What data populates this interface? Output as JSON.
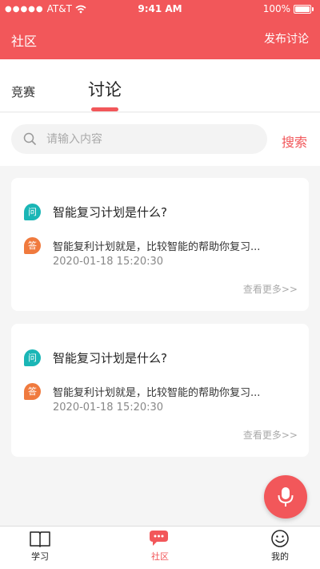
{
  "status_bar": {
    "carrier": "AT&T",
    "time": "9:41 AM",
    "battery": "100%"
  },
  "header": {
    "title": "社区",
    "action": "发布讨论"
  },
  "tabs": [
    {
      "label": "竞赛",
      "active": false
    },
    {
      "label": "讨论",
      "active": true
    }
  ],
  "search": {
    "placeholder": "请输入内容",
    "button": "搜索"
  },
  "posts": [
    {
      "question_badge": "问",
      "question": "智能复习计划是什么?",
      "answer_badge": "答",
      "answer": "智能复利计划就是，比较智能的帮助你复习...",
      "timestamp": "2020-01-18   15:20:30",
      "more": "查看更多>>"
    },
    {
      "question_badge": "问",
      "question": "智能复习计划是什么?",
      "answer_badge": "答",
      "answer": "智能复利计划就是，比较智能的帮助你复习...",
      "timestamp": "2020-01-18   15:20:30",
      "more": "查看更多>>"
    }
  ],
  "tabbar": [
    {
      "label": "学习",
      "icon": "book-icon"
    },
    {
      "label": "社区",
      "icon": "chat-icon",
      "active": true
    },
    {
      "label": "我的",
      "icon": "smiley-icon"
    }
  ],
  "colors": {
    "accent": "#f2575a",
    "question_badge": "#1ab6b6",
    "answer_badge": "#f07a3e"
  }
}
